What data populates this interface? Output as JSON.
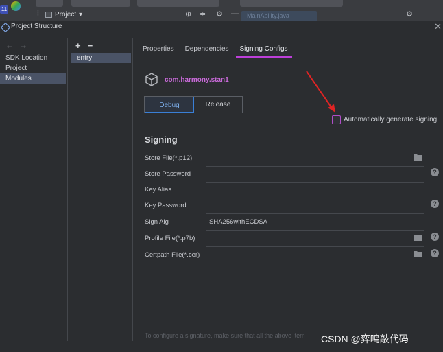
{
  "ide": {
    "badge": "11",
    "project_label": "Project",
    "blur_tab": "MainAbility.java"
  },
  "dialog": {
    "title": "Project Structure",
    "close_glyph": "✕"
  },
  "left": {
    "back_glyph": "←",
    "forward_glyph": "→",
    "items": [
      {
        "label": "SDK Location",
        "selected": false
      },
      {
        "label": "Project",
        "selected": false
      },
      {
        "label": "Modules",
        "selected": true
      }
    ]
  },
  "mid": {
    "add_glyph": "+",
    "remove_glyph": "−",
    "items": [
      {
        "label": "entry",
        "selected": true
      }
    ]
  },
  "tabs": {
    "properties": "Properties",
    "dependencies": "Dependencies",
    "signing": "Signing Configs",
    "active": "Signing Configs"
  },
  "module": {
    "name": "com.harmony.stan1",
    "icon": "cube-icon"
  },
  "build_types": {
    "debug": "Debug",
    "release": "Release",
    "selected": "Debug"
  },
  "auto_sign": {
    "label": "Automatically generate signing",
    "checked": false
  },
  "signing": {
    "heading": "Signing",
    "fields": {
      "store_file": {
        "label": "Store File(*.p12)",
        "value": ""
      },
      "store_password": {
        "label": "Store Password",
        "value": ""
      },
      "key_alias": {
        "label": "Key Alias",
        "value": ""
      },
      "key_password": {
        "label": "Key Password",
        "value": ""
      },
      "sign_alg": {
        "label": "Sign Alg",
        "value": "SHA256withECDSA"
      },
      "profile_file": {
        "label": "Profile File(*.p7b)",
        "value": ""
      },
      "certpath_file": {
        "label": "Certpath File(*.cer)",
        "value": ""
      }
    },
    "help_glyph": "?"
  },
  "footer_note": "To configure a signature, make sure that all the above item",
  "watermark": "CSDN @弈鸣敲代码",
  "colors": {
    "accent_purple": "#bd3fd9",
    "selection": "#4a5366",
    "debug_blue": "#3a7fd6",
    "arrow_red": "#e02424"
  }
}
